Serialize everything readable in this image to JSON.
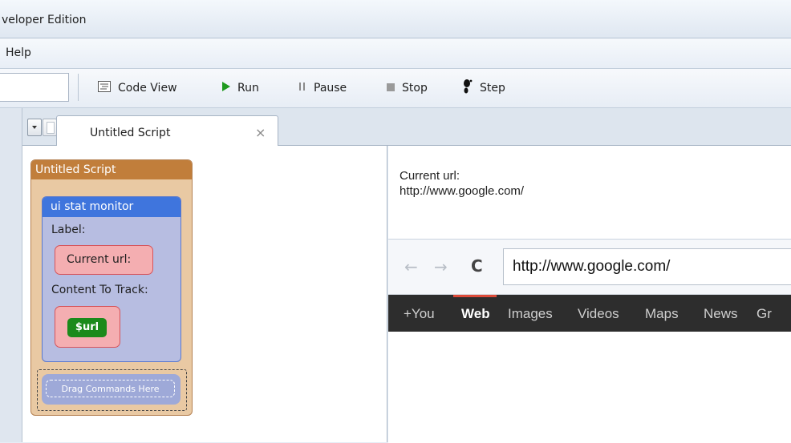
{
  "window": {
    "title": "veloper Edition"
  },
  "menu": {
    "help": "Help"
  },
  "toolbar": {
    "code_view": "Code View",
    "run": "Run",
    "pause": "Pause",
    "stop": "Stop",
    "step": "Step"
  },
  "tabs": {
    "active": "Untitled Script",
    "close": "×"
  },
  "script": {
    "title": "Untitled Script",
    "monitor_header": "ui stat monitor",
    "label_caption": "Label:",
    "label_value": "Current url:",
    "content_caption": "Content To Track:",
    "content_value": "$url",
    "drag_hint": "Drag Commands Here"
  },
  "output": {
    "line1": "Current url:",
    "line2": "http://www.google.com/"
  },
  "browser": {
    "url": "http://www.google.com/",
    "nav_items": [
      "+You",
      "Web",
      "Images",
      "Videos",
      "Maps",
      "News",
      "Gr"
    ],
    "active_item": "Web"
  }
}
